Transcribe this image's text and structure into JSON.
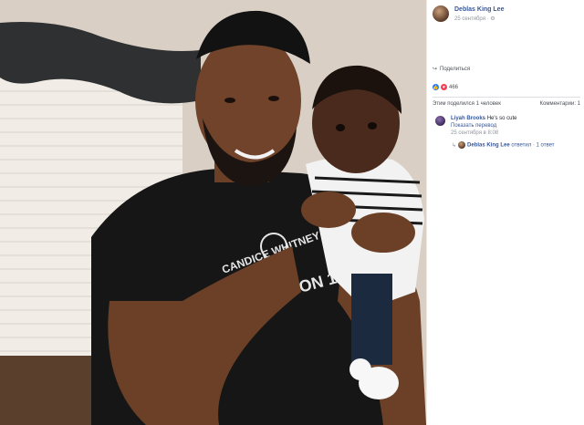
{
  "post": {
    "author": "Deblas King Lee",
    "date": "25 сентября · ⚙"
  },
  "actions": {
    "share_label": "Поделиться"
  },
  "reactions": {
    "count": "466"
  },
  "comments_bar": {
    "shared_label": "Этим поделился 1 человек",
    "comments_label": "Комментарии: 1"
  },
  "comment": {
    "author": "Liyah Brooks",
    "text": "He's so cute",
    "translate": "Показать перевод",
    "date": "25 сентября в 8:08"
  },
  "reply": {
    "author": "Deblas King Lee",
    "text": "ответил · 1 ответ"
  }
}
